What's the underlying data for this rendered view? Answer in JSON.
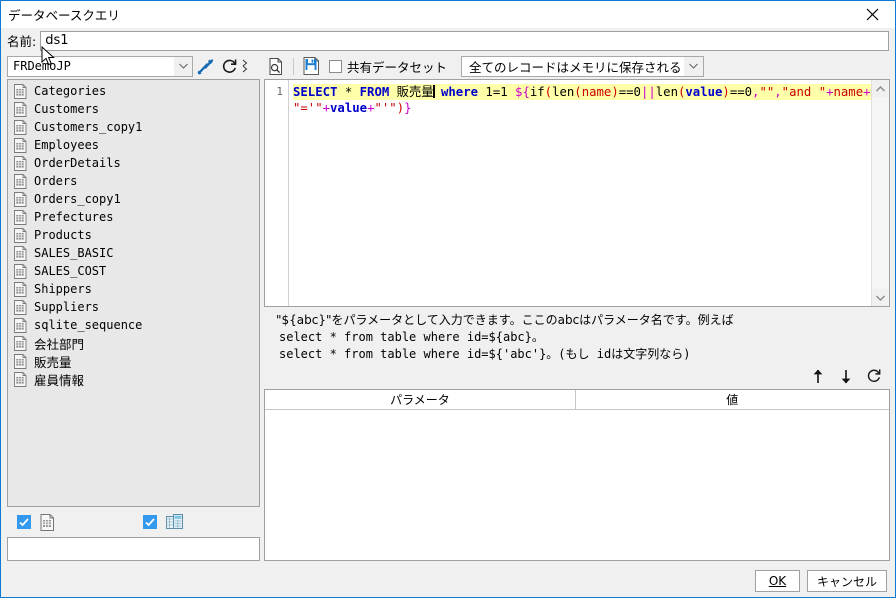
{
  "window": {
    "title": "データベースクエリ",
    "close_icon": "close-icon"
  },
  "name_field": {
    "label": "名前:",
    "value": "ds1",
    "placeholder": ""
  },
  "database": {
    "selected": "FRDemoJP",
    "edit_icon": "wrench-screwdriver-icon",
    "refresh_icon": "refresh-icon",
    "overflow_icon": "overflow-chevrons-icon"
  },
  "table_list": {
    "items": [
      {
        "label": "Categories",
        "jp": false
      },
      {
        "label": "Customers",
        "jp": false
      },
      {
        "label": "Customers_copy1",
        "jp": false
      },
      {
        "label": "Employees",
        "jp": false
      },
      {
        "label": "OrderDetails",
        "jp": false
      },
      {
        "label": "Orders",
        "jp": false
      },
      {
        "label": "Orders_copy1",
        "jp": false
      },
      {
        "label": "Prefectures",
        "jp": false
      },
      {
        "label": "Products",
        "jp": false
      },
      {
        "label": "SALES_BASIC",
        "jp": false
      },
      {
        "label": "SALES_COST",
        "jp": false
      },
      {
        "label": "Shippers",
        "jp": false
      },
      {
        "label": "Suppliers",
        "jp": false
      },
      {
        "label": "sqlite_sequence",
        "jp": false
      },
      {
        "label": "会社部門",
        "jp": true
      },
      {
        "label": "販売量",
        "jp": true
      },
      {
        "label": "雇員情報",
        "jp": true
      }
    ]
  },
  "left_footer": {
    "checkbox_table_checked": true,
    "table_icon": "table-icon",
    "checkbox_view_checked": true,
    "view_icon": "view-tables-icon"
  },
  "sql_toolbar": {
    "preview_icon": "preview-magnifier-icon",
    "save_icon": "save-icon",
    "shared_dataset_label": "共有データセット",
    "shared_dataset_checked": false,
    "memory_mode": "全てのレコードはメモリに保存される",
    "memory_dropdown_icon": "chevron-down-icon"
  },
  "sql_editor": {
    "line_numbers": [
      "1"
    ],
    "line1_tokens": [
      {
        "t": "SELECT",
        "c": "kw"
      },
      {
        "t": " * ",
        "c": "ident"
      },
      {
        "t": "FROM",
        "c": "kw"
      },
      {
        "t": " ",
        "c": "ident"
      },
      {
        "t": "販売量",
        "c": "jpname"
      },
      {
        "t": "CARET",
        "c": "caret"
      },
      {
        "t": " ",
        "c": "ident"
      },
      {
        "t": "where",
        "c": "kw"
      },
      {
        "t": " 1=1 ",
        "c": "num"
      },
      {
        "t": "${",
        "c": "op"
      },
      {
        "t": "if",
        "c": "fn"
      },
      {
        "t": "(",
        "c": "paren"
      },
      {
        "t": "len",
        "c": "fn"
      },
      {
        "t": "(",
        "c": "paren"
      },
      {
        "t": "name",
        "c": "rd"
      },
      {
        "t": ")",
        "c": "paren"
      },
      {
        "t": "==0",
        "c": "num"
      },
      {
        "t": "||",
        "c": "op"
      },
      {
        "t": "len",
        "c": "fn"
      },
      {
        "t": "(",
        "c": "paren"
      },
      {
        "t": "value",
        "c": "var"
      },
      {
        "t": ")",
        "c": "paren"
      },
      {
        "t": "==0",
        "c": "num"
      },
      {
        "t": ",",
        "c": "op"
      },
      {
        "t": "\"\"",
        "c": "str"
      },
      {
        "t": ",",
        "c": "op"
      },
      {
        "t": "\"and \"",
        "c": "str"
      },
      {
        "t": "+",
        "c": "op"
      },
      {
        "t": "name",
        "c": "rd"
      },
      {
        "t": "+",
        "c": "op"
      }
    ],
    "line2_tokens": [
      {
        "t": "\"='\"",
        "c": "str"
      },
      {
        "t": "+",
        "c": "op"
      },
      {
        "t": "value",
        "c": "var"
      },
      {
        "t": "+",
        "c": "op"
      },
      {
        "t": "\"'\"",
        "c": "str"
      },
      {
        "t": ")",
        "c": "paren"
      },
      {
        "t": "}",
        "c": "op"
      }
    ],
    "full_text": "SELECT * FROM 販売量 where 1=1 ${if(len(name)==0||len(value)==0,\"\",\"and \"+name+\"='\"+value+\"'\")}",
    "scroll_up_icon": "chevron-up-icon",
    "scroll_down_icon": "chevron-down-icon"
  },
  "help": {
    "line1": "\"${abc}\"をパラメータとして入力できます。ここのabcはパラメータ名です。例えば",
    "line2": "select * from table where id=${abc}。",
    "line3": "select * from table where id=${'abc'}。(もし idは文字列なら)"
  },
  "param_toolbar": {
    "move_up_icon": "arrow-up-icon",
    "move_down_icon": "arrow-down-icon",
    "refresh_icon": "refresh-icon"
  },
  "param_table": {
    "columns": [
      "パラメータ",
      "値"
    ],
    "rows": []
  },
  "footer": {
    "ok_label": "OK",
    "ok_mnemonic": "O",
    "cancel_label": "キャンセル"
  },
  "colors": {
    "accent": "#0a7ad4",
    "checkbox_blue": "#3399ef",
    "code_highlight": "#ffffaa",
    "keyword": "#0000cc",
    "string": "#cc0000",
    "operator": "#cc00cc",
    "panel_bg": "#f0f0f0",
    "list_bg": "#e8e8e8"
  }
}
